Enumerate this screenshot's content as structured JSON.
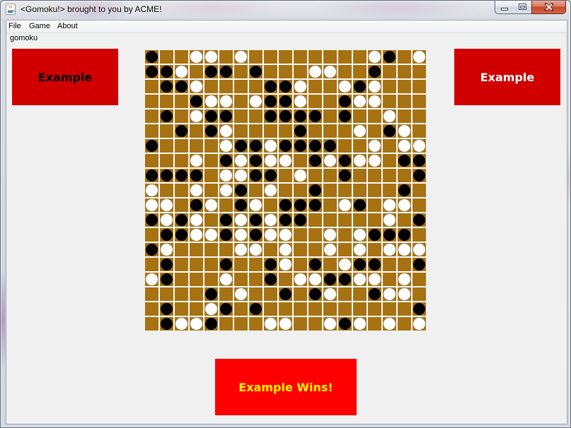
{
  "window": {
    "title": "<Gomoku!> brought to you by ACME!",
    "icons": {
      "app": "java-app-icon",
      "minimize": "minimize-icon",
      "maximize": "maximize-icon",
      "close": "close-icon"
    }
  },
  "menu": [
    {
      "label": "File"
    },
    {
      "label": "Game"
    },
    {
      "label": "About"
    }
  ],
  "panel_label": "gomoku",
  "players": [
    {
      "name": "Example",
      "text_color": "#000000",
      "background": "#d10000"
    },
    {
      "name": "Example",
      "text_color": "#ffffff",
      "background": "#d10000"
    }
  ],
  "result": {
    "text": "Example Wins!",
    "text_color": "#ffff00",
    "background": "#ff0000"
  },
  "colors": {
    "window_background": "#f0f0f0"
  },
  "board": {
    "cell_color": "#a67212",
    "line_color": "#fafafa",
    "stones": [
      [
        "black",
        null,
        null,
        "white",
        "white",
        null,
        "white",
        null,
        null,
        null,
        null,
        null,
        null,
        null,
        null,
        "white",
        "black",
        null,
        "white"
      ],
      [
        "black",
        "black",
        "white",
        null,
        "black",
        "black",
        null,
        "black",
        null,
        null,
        null,
        "white",
        "white",
        null,
        null,
        "black",
        null,
        null,
        null
      ],
      [
        null,
        "black",
        "black",
        "white",
        null,
        null,
        null,
        null,
        "black",
        "black",
        "white",
        null,
        null,
        "white",
        "black",
        "white",
        null,
        null,
        null
      ],
      [
        null,
        null,
        null,
        "black",
        "white",
        "white",
        null,
        "white",
        "black",
        "black",
        "white",
        null,
        null,
        "black",
        "white",
        "white",
        null,
        null,
        null
      ],
      [
        null,
        "black",
        null,
        "white",
        "black",
        "black",
        null,
        null,
        "black",
        "black",
        "black",
        "black",
        null,
        "black",
        null,
        null,
        "white",
        null,
        null
      ],
      [
        null,
        null,
        "black",
        null,
        "black",
        "white",
        null,
        null,
        null,
        null,
        "black",
        null,
        null,
        null,
        "white",
        null,
        "black",
        "white",
        null
      ],
      [
        "black",
        null,
        null,
        null,
        null,
        "white",
        "black",
        "black",
        "white",
        "black",
        "black",
        "black",
        "black",
        null,
        null,
        "white",
        null,
        "white",
        "white"
      ],
      [
        null,
        null,
        null,
        "white",
        null,
        "black",
        "white",
        "black",
        "white",
        "white",
        null,
        "black",
        "white",
        "black",
        "white",
        "white",
        null,
        "black",
        "black"
      ],
      [
        "black",
        "black",
        "black",
        "black",
        null,
        "white",
        "white",
        "black",
        "black",
        null,
        "white",
        null,
        null,
        "black",
        null,
        null,
        null,
        null,
        "black"
      ],
      [
        "white",
        null,
        null,
        "white",
        null,
        "white",
        "black",
        null,
        "white",
        null,
        null,
        "black",
        null,
        null,
        null,
        null,
        null,
        "black",
        null
      ],
      [
        "white",
        "white",
        null,
        "black",
        "white",
        null,
        "black",
        "white",
        null,
        "black",
        "black",
        "black",
        null,
        "white",
        "black",
        null,
        "white",
        "white",
        null
      ],
      [
        "black",
        "white",
        "black",
        "white",
        null,
        "black",
        "white",
        "black",
        "white",
        "black",
        "black",
        null,
        null,
        null,
        null,
        null,
        "white",
        null,
        "black"
      ],
      [
        null,
        "black",
        "black",
        "white",
        "white",
        "black",
        "white",
        "black",
        "white",
        "white",
        null,
        null,
        "white",
        null,
        "white",
        "black",
        "black",
        "black",
        null
      ],
      [
        "black",
        "white",
        null,
        null,
        null,
        null,
        "white",
        "white",
        null,
        "white",
        null,
        null,
        "white",
        null,
        "white",
        null,
        "white",
        "white",
        "white"
      ],
      [
        null,
        "black",
        null,
        null,
        null,
        "black",
        null,
        null,
        "black",
        "white",
        null,
        "black",
        null,
        "white",
        "black",
        "black",
        null,
        null,
        "black"
      ],
      [
        "white",
        "black",
        null,
        null,
        null,
        "white",
        null,
        null,
        "black",
        null,
        "white",
        "white",
        "black",
        "black",
        "white",
        "white",
        null,
        "white",
        null
      ],
      [
        null,
        null,
        null,
        null,
        "black",
        null,
        "white",
        null,
        null,
        "black",
        null,
        "black",
        "white",
        null,
        null,
        "black",
        "white",
        "white",
        null
      ],
      [
        null,
        "black",
        null,
        null,
        "white",
        "black",
        null,
        "black",
        null,
        null,
        null,
        null,
        null,
        null,
        null,
        null,
        null,
        null,
        "black"
      ],
      [
        null,
        "black",
        "white",
        "white",
        "black",
        null,
        null,
        null,
        "white",
        "white",
        null,
        null,
        "white",
        "black",
        "white",
        null,
        "white",
        null,
        "white"
      ]
    ]
  }
}
